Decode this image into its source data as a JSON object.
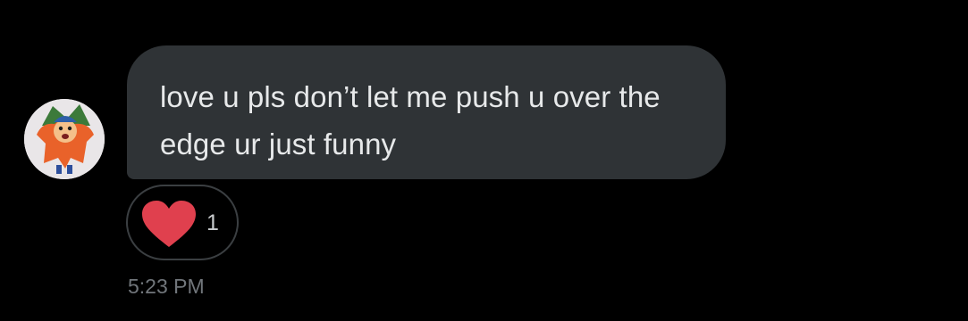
{
  "message": {
    "text": "love u pls don’t let me push u over the edge ur just funny",
    "timestamp": "5:23 PM"
  },
  "reaction": {
    "icon": "heart-icon",
    "count": "1",
    "color": "#e0404e"
  },
  "avatar": {
    "icon": "cartoon-character-avatar"
  },
  "colors": {
    "background": "#000000",
    "bubble": "#2f3336",
    "text": "#e7e9ea",
    "muted": "#71767b"
  }
}
